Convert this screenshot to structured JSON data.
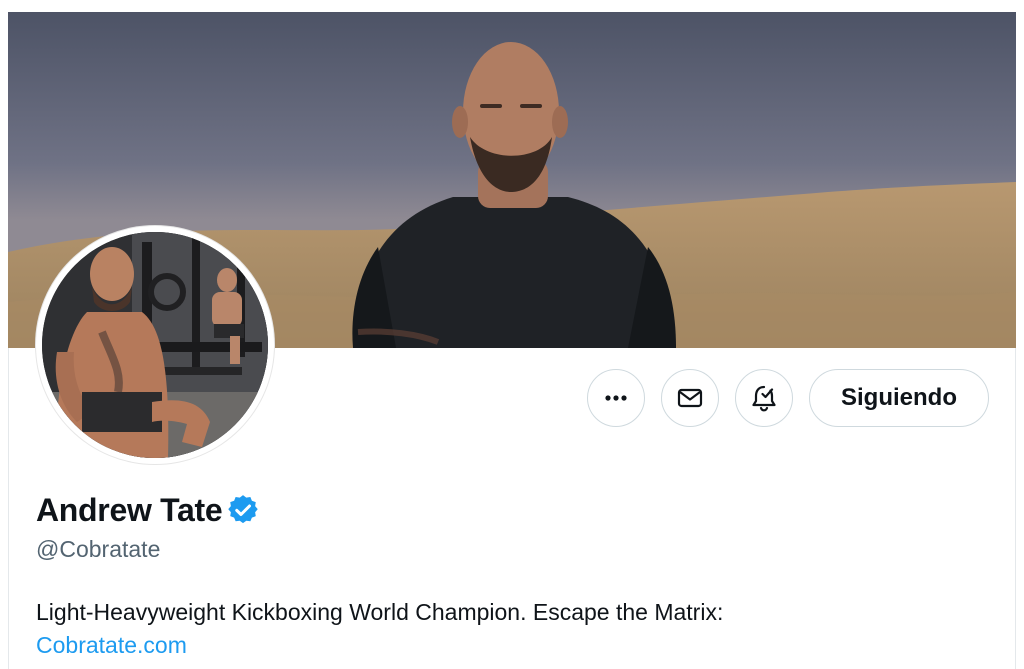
{
  "profile": {
    "display_name": "Andrew Tate",
    "handle": "@Cobratate",
    "verified": true,
    "bio_text": "Light-Heavyweight Kickboxing World Champion. Escape the Matrix:",
    "bio_link": "Cobratate.com"
  },
  "actions": {
    "more_icon": "more-horizontal-icon",
    "message_icon": "envelope-icon",
    "notifications_icon": "bell-check-icon",
    "follow_label": "Siguiendo"
  },
  "colors": {
    "link": "#1d9bf0",
    "verified_badge": "#1d9bf0",
    "primary_text": "#0f1419",
    "secondary_text": "#536471",
    "button_border": "#cfd9de"
  }
}
